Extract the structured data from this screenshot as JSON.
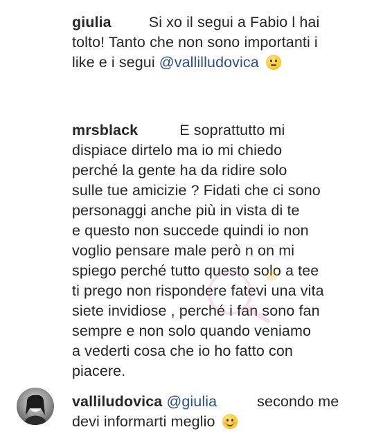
{
  "comments": [
    {
      "username": "giulia",
      "lines": [
        "Si xo il segui a Fabio l hai",
        "tolto! Tanto che non sono importanti i",
        "like e i segui"
      ],
      "mention": "@vallilludovica",
      "emoji": "neutral-face-emoji"
    },
    {
      "username": "mrsblack",
      "lines": [
        "E soprattutto mi",
        "dispiace dirtelo ma io mi chiedo",
        "perché la gente ha da ridire solo",
        "sulle tue amicizie ? Fidati che ci sono",
        "personaggi anche più in vista di te",
        "e questo non succede quindi io non",
        "voglio pensare male però n on mi",
        "spiego perché tutto questo solo a tee",
        "ti prego non rispondere fatevi una vita",
        "siete invidiose , perché i fan sono fan",
        "sempre e non solo quando veniamo",
        "a vederti cosa che io ho fatto con",
        "piacere."
      ]
    },
    {
      "username": "valliludovica",
      "mention": "@giulia",
      "lines": [
        "secondo me",
        "devi informarti meglio"
      ],
      "emoji": "smiling-face-emoji"
    }
  ]
}
